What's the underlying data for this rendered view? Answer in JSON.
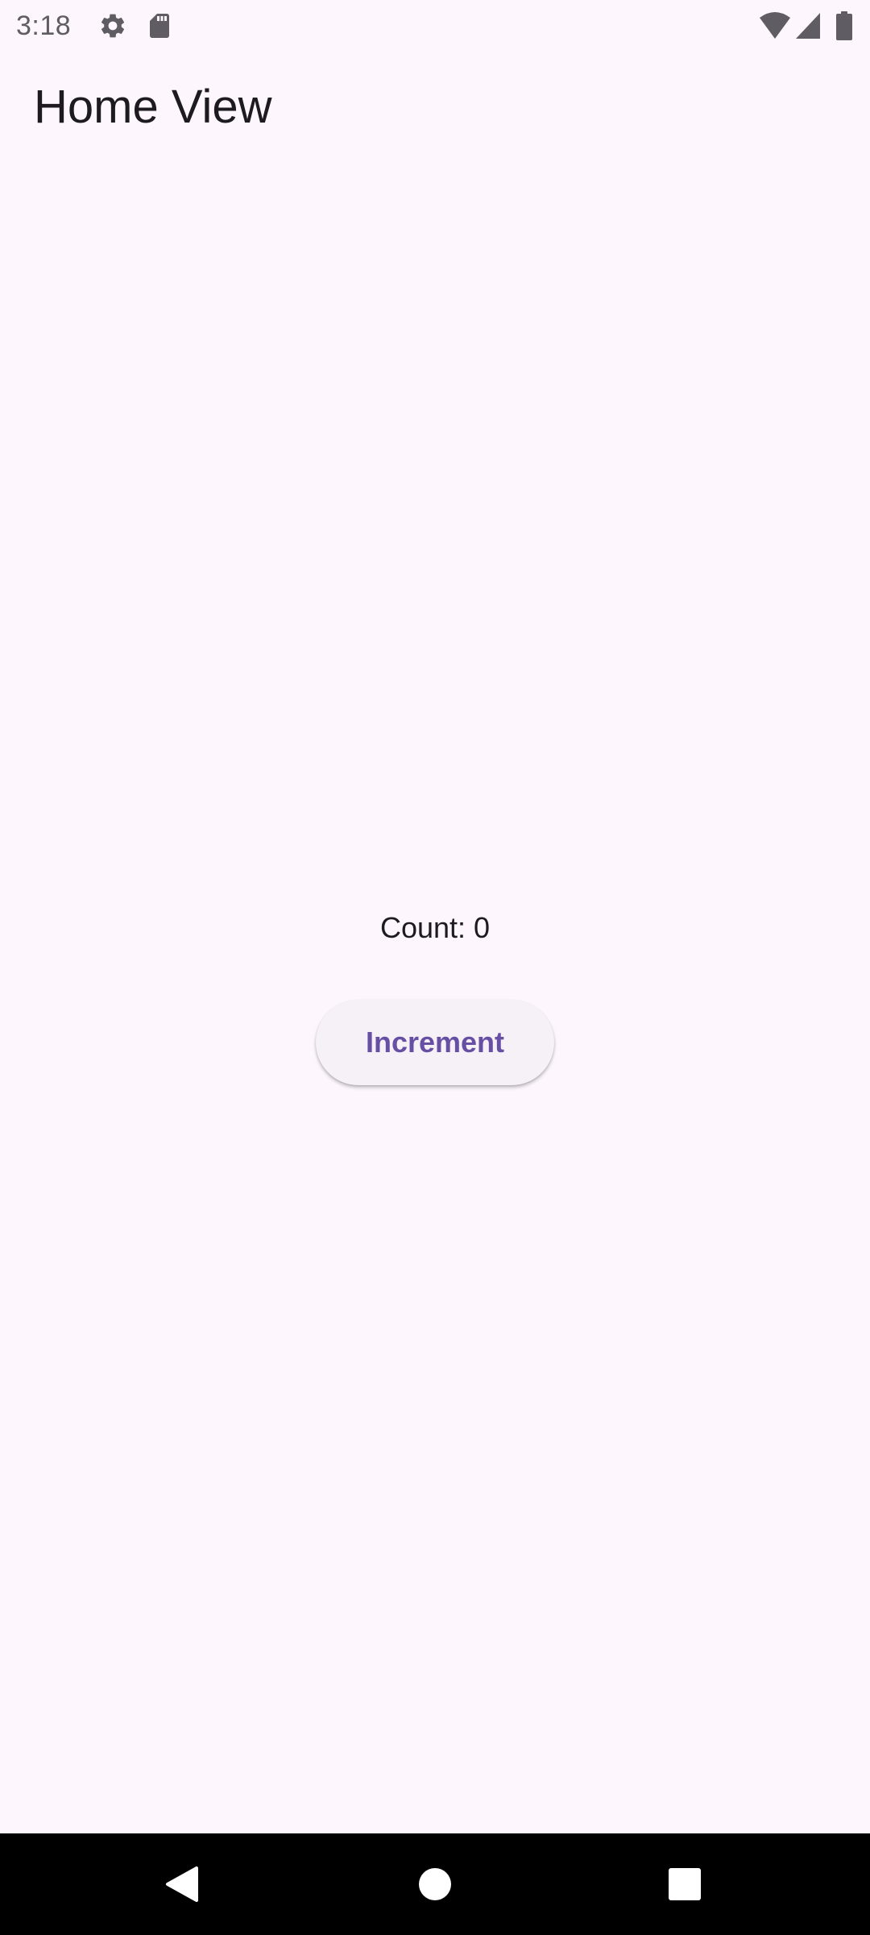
{
  "status_bar": {
    "time": "3:18",
    "left_icons": [
      "gear-icon",
      "sd-card-icon"
    ],
    "right_icons": [
      "wifi-icon",
      "signal-icon",
      "battery-icon"
    ],
    "icon_color": "#5F5C63"
  },
  "app_bar": {
    "title": "Home View"
  },
  "content": {
    "count_text": "Count: 0",
    "increment_label": "Increment"
  },
  "nav_bar": {
    "buttons": [
      "back-icon",
      "home-icon",
      "recents-icon"
    ]
  },
  "colors": {
    "background": "#FDF7FD",
    "primary": "#6750A4",
    "button_surface": "#F6F1F6",
    "on_surface": "#1D1B20",
    "nav_background": "#000000"
  }
}
